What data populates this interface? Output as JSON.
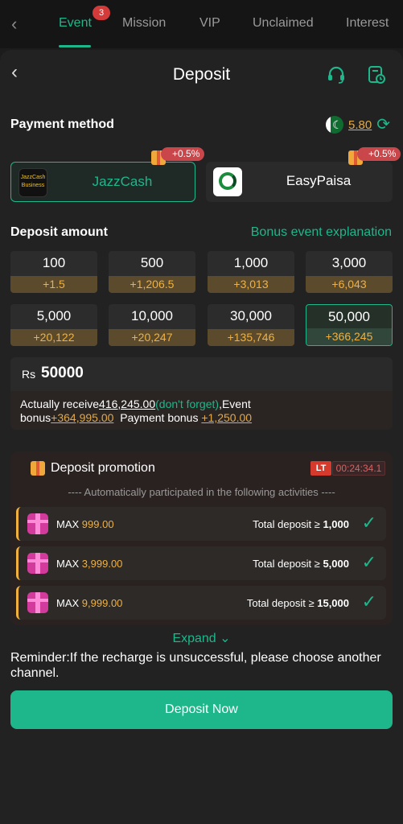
{
  "tabs": {
    "items": [
      "Event",
      "Mission",
      "VIP",
      "Unclaimed",
      "Interest"
    ],
    "badge": "3"
  },
  "header": {
    "title": "Deposit"
  },
  "payment": {
    "label": "Payment method",
    "balance": "5.80",
    "methods": [
      {
        "name": "JazzCash",
        "logo_text": "JazzCash Business",
        "tag": "+0.5%"
      },
      {
        "name": "EasyPaisa",
        "tag": "+0.5%"
      }
    ]
  },
  "deposit_amount": {
    "label": "Deposit amount",
    "bonus_link": "Bonus event explanation",
    "tiles": [
      {
        "amount": "100",
        "bonus": "+1.5"
      },
      {
        "amount": "500",
        "bonus": "+1,206.5"
      },
      {
        "amount": "1,000",
        "bonus": "+3,013"
      },
      {
        "amount": "3,000",
        "bonus": "+6,043"
      },
      {
        "amount": "5,000",
        "bonus": "+20,122"
      },
      {
        "amount": "10,000",
        "bonus": "+20,247"
      },
      {
        "amount": "30,000",
        "bonus": "+135,746"
      },
      {
        "amount": "50,000",
        "bonus": "+366,245"
      }
    ]
  },
  "input": {
    "currency": "Rs",
    "value": "50000"
  },
  "receive": {
    "prefix": "Actually receive",
    "amount": "416,245.00",
    "note": "(don't forget)",
    "event_label": ",Event",
    "bonus_label": "bonus",
    "event_bonus": "+364,995.00",
    "payment_label": "Payment bonus",
    "payment_bonus": "+1,250.00"
  },
  "promotion": {
    "title": "Deposit promotion",
    "lt": "LT",
    "timer": "00:24:34.1",
    "subtitle": "---- Automatically participated in the following activities ----",
    "rows": [
      {
        "max_label": "MAX",
        "max_value": "999.00",
        "cond_label": "Total deposit ≥",
        "cond_value": "1,000"
      },
      {
        "max_label": "MAX",
        "max_value": "3,999.00",
        "cond_label": "Total deposit ≥",
        "cond_value": "5,000"
      },
      {
        "max_label": "MAX",
        "max_value": "9,999.00",
        "cond_label": "Total deposit ≥",
        "cond_value": "15,000"
      }
    ]
  },
  "expand": "Expand ⌄",
  "reminder": "Reminder:If the recharge is unsuccessful, please choose another channel.",
  "button": "Deposit Now"
}
